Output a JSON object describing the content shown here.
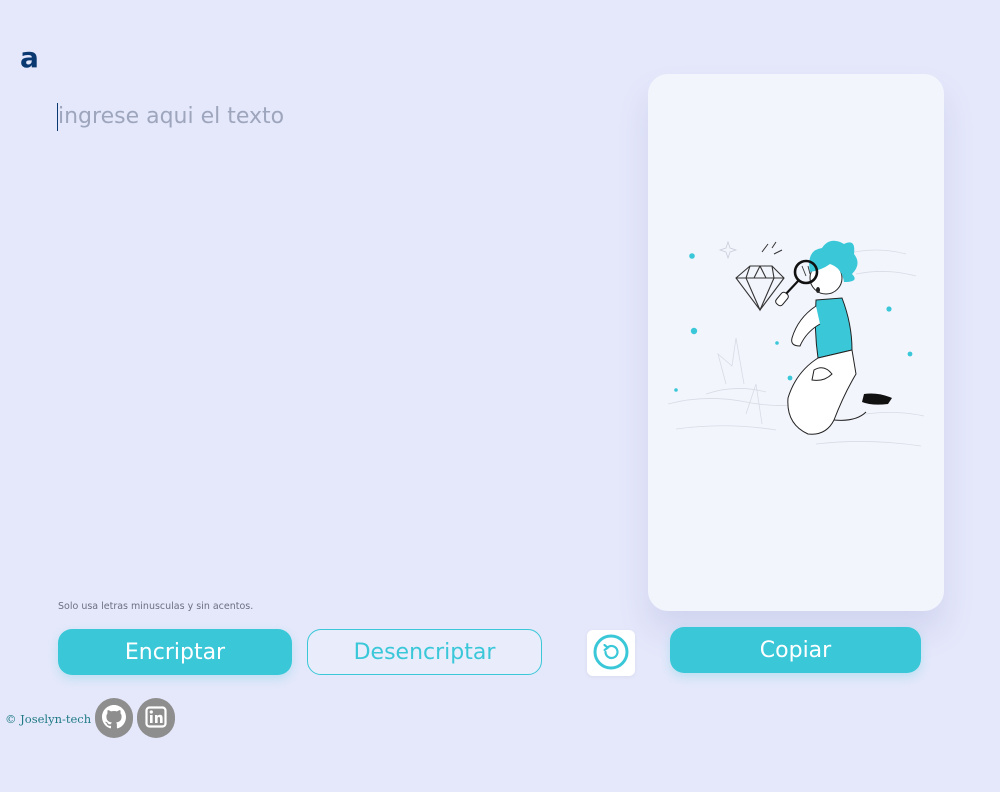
{
  "logo": {
    "text": "a"
  },
  "input": {
    "placeholder": "ingrese aqui el texto",
    "value": ""
  },
  "hint": {
    "text": "Solo usa letras minusculas y sin acentos."
  },
  "buttons": {
    "encrypt_label": "Encriptar",
    "decrypt_label": "Desencriptar",
    "copy_label": "Copiar"
  },
  "footer": {
    "copyright": "© Joselyn-tech"
  },
  "colors": {
    "accent": "#3ac8d9",
    "brand_dark": "#0a3871",
    "background": "#e5e8fb",
    "card": "#f3f5fd"
  },
  "icons": {
    "reset": "reset-icon",
    "github": "github-icon",
    "linkedin": "linkedin-icon"
  }
}
